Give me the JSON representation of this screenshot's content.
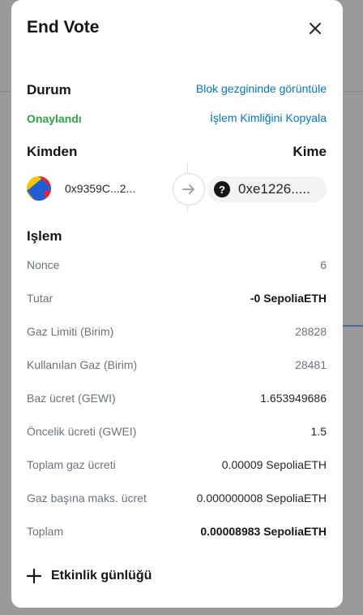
{
  "modal": {
    "title": "End Vote",
    "status_heading": "Durum",
    "status_value": "Onaylandı",
    "explorer_link": "Blok gezgininde görüntüle",
    "copy_tx_link": "İşlem Kimliğini Kopyala",
    "from_heading": "Kimden",
    "to_heading": "Kime",
    "from_address": "0x9359C...2...",
    "to_address": "0xe1226.....",
    "to_icon_glyph": "?",
    "tx_heading": "Işlem",
    "rows": [
      {
        "label": "Nonce",
        "value": "6"
      },
      {
        "label": "Tutar",
        "value": "-0 SepoliaETH"
      },
      {
        "label": "Gaz Limiti (Birim)",
        "value": "28828"
      },
      {
        "label": "Kullanılan Gaz (Birim)",
        "value": "28481"
      },
      {
        "label": "Baz ücret (GEWI)",
        "value": "1.653949686"
      },
      {
        "label": "Öncelik ücreti (GWEI)",
        "value": "1.5"
      },
      {
        "label": "Toplam gaz ücreti",
        "value": "0.00009 SepoliaETH"
      },
      {
        "label": "Gaz başına maks. ücret",
        "value": "0.000000008 SepoliaETH"
      },
      {
        "label": "Toplam",
        "value": "0.00008983 SepoliaETH"
      }
    ],
    "activity_log": "Etkinlik günlüğü"
  },
  "colors": {
    "link": "#0376c9",
    "success": "#28a745",
    "muted_text": "#6a737d"
  },
  "icons": {
    "close": "close-icon",
    "arrow": "arrow-right-icon",
    "question": "question-icon",
    "plus": "plus-icon"
  }
}
